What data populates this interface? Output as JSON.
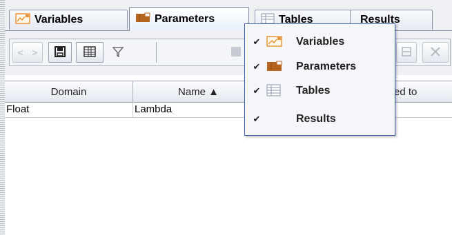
{
  "tabs": [
    {
      "label": "Variables",
      "icon": "variables-icon",
      "active": false
    },
    {
      "label": "Parameters",
      "icon": "parameters-icon",
      "active": true
    },
    {
      "label": "Tables",
      "icon": "tables-icon",
      "active": false
    },
    {
      "label": "Results",
      "icon": "",
      "active": false
    }
  ],
  "toolbar": {
    "prev_label": "<",
    "next_label": ">",
    "icons": [
      "save-icon",
      "columns-icon",
      "filter-icon",
      "grid-icon",
      "remove-row-icon",
      "delete-icon"
    ]
  },
  "table": {
    "columns": [
      "Domain",
      "Name ▲",
      "ed to"
    ],
    "rows": [
      [
        "Float",
        "Lambda",
        ""
      ]
    ]
  },
  "menu": {
    "items": [
      {
        "label": "Variables",
        "checked": true,
        "check_glyph": "✔",
        "icon": "variables-icon"
      },
      {
        "label": "Parameters",
        "checked": true,
        "check_glyph": "✔",
        "icon": "parameters-icon"
      },
      {
        "label": "Tables",
        "checked": true,
        "check_glyph": "✔",
        "icon": "tables-icon"
      },
      {
        "label": "Results",
        "checked": true,
        "check_glyph": "✔",
        "icon": ""
      }
    ]
  },
  "colors": {
    "accent": "#3b5dab",
    "tab_border": "#7f8aa0",
    "background": "#eef0f4",
    "parameters_icon": "#b5651d",
    "variables_icon": "#e8943a"
  }
}
